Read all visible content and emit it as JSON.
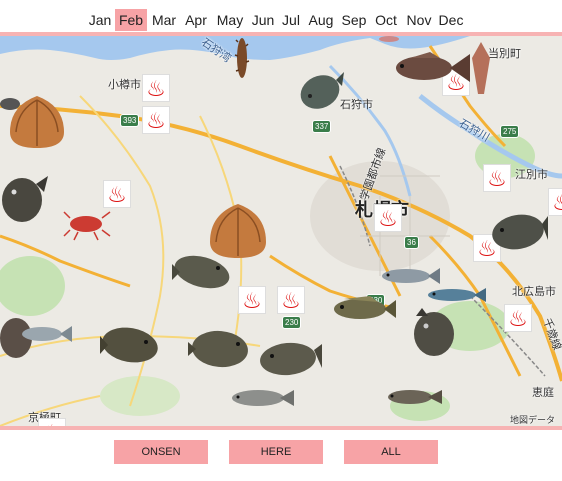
{
  "months": [
    {
      "label": "Jan",
      "active": false
    },
    {
      "label": "Feb",
      "active": true
    },
    {
      "label": "Mar",
      "active": false
    },
    {
      "label": "Apr",
      "active": false
    },
    {
      "label": "May",
      "active": false
    },
    {
      "label": "Jun",
      "active": false
    },
    {
      "label": "Jul",
      "active": false
    },
    {
      "label": "Aug",
      "active": false
    },
    {
      "label": "Sep",
      "active": false
    },
    {
      "label": "Oct",
      "active": false
    },
    {
      "label": "Nov",
      "active": false
    },
    {
      "label": "Dec",
      "active": false
    }
  ],
  "map": {
    "labels": {
      "otaru": "小樽市",
      "ishikari": "石狩市",
      "tobetsu": "当別町",
      "ishikari_river": "石狩川",
      "ishikari_bay": "石狩湾",
      "sapporo": "札幌市",
      "ebetsu": "江別市",
      "kitahiroshima": "北広島市",
      "eniwa": "恵庭",
      "kyogoku": "京極町",
      "chitose_line": "千歳線",
      "gakuentoshi_line": "学園都市線",
      "attribution": "地図データ"
    },
    "shields": {
      "r393": "393",
      "r337": "337",
      "r275": "275",
      "r36": "36",
      "r230a": "230",
      "r230b": "230"
    },
    "colors": {
      "sea": "#a5c8ee",
      "land": "#eceae4",
      "park": "#c6e2b4",
      "highway": "#f3b135",
      "road": "#ffffff"
    }
  },
  "onsen_glyph": "♨",
  "buttons": {
    "onsen": "ONSEN",
    "here": "HERE",
    "all": "ALL"
  }
}
